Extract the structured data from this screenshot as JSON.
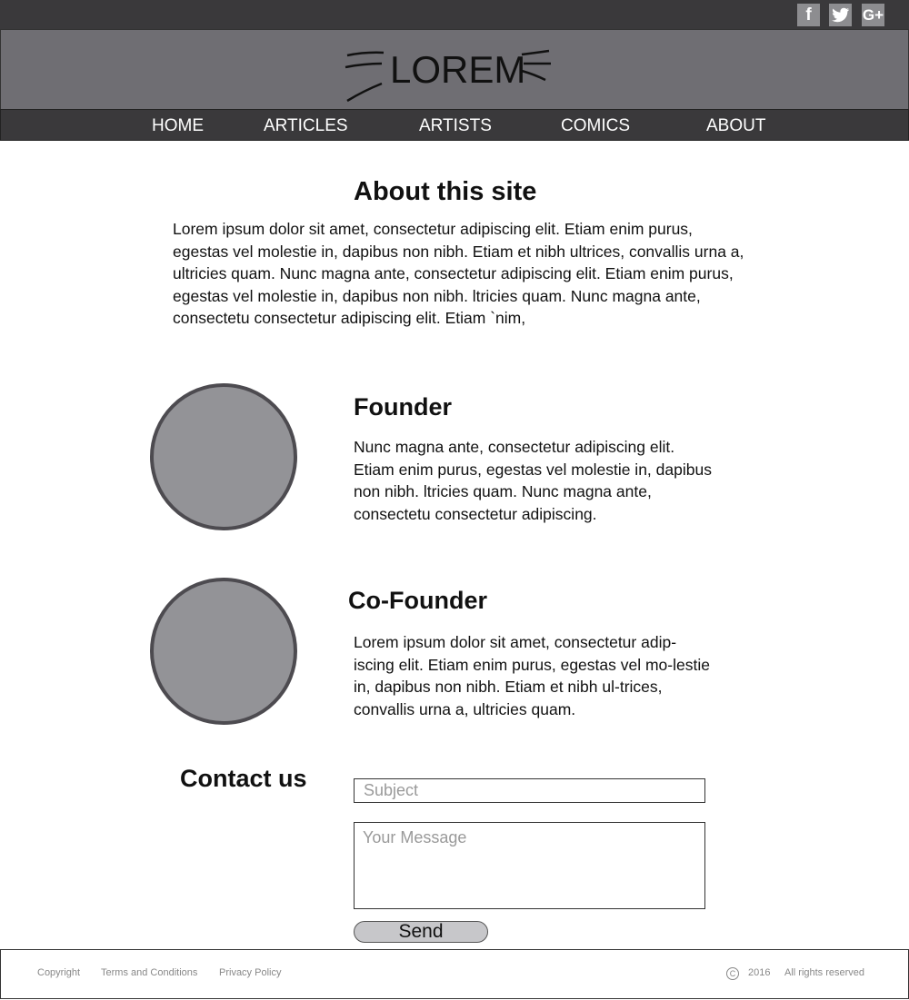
{
  "social": {
    "facebook": "f",
    "twitter": "🐦",
    "googleplus": "G+"
  },
  "logo": {
    "text": "LOREM"
  },
  "nav": [
    "HOME",
    "ARTICLES",
    "ARTISTS",
    "COMICS",
    "ABOUT"
  ],
  "about": {
    "title": "About this site",
    "body": "Lorem ipsum dolor sit amet, consectetur adipiscing elit. Etiam enim purus, egestas vel molestie in, dapibus non nibh. Etiam et nibh ultrices, convallis urna a, ultricies quam. Nunc magna ante,  consectetur adipiscing elit. Etiam enim purus, egestas vel molestie in, dapibus non nibh. ltricies quam. Nunc magna ante,  consectetu   consectetur adipiscing elit. Etiam `nim,"
  },
  "founder": {
    "title": "Founder",
    "body": "Nunc magna ante,  consectetur adipiscing elit. Etiam enim purus, egestas vel molestie in, dapibus non nibh. ltricies quam. Nunc magna ante,  consectetu   consectetur adipiscing."
  },
  "cofounder": {
    "title": "Co-Founder",
    "body": "Lorem ipsum dolor sit amet, consectetur adip-iscing elit. Etiam enim purus, egestas vel mo-lestie in, dapibus non nibh. Etiam et nibh ul-trices, convallis urna a, ultricies quam."
  },
  "contact": {
    "title": "Contact us",
    "subject_placeholder": "Subject",
    "message_placeholder": "Your Message",
    "send_label": "Send"
  },
  "footer": {
    "copyright": "Copyright",
    "terms": "Terms and Conditions",
    "privacy": "Privacy Policy",
    "copy_symbol": "C",
    "year": "2016",
    "rights": "All rights reserved"
  },
  "colors": {
    "topbar": "#3a393b",
    "header": "#6f6e73",
    "avatar": "#939397",
    "avatar_border": "#4d4b50"
  }
}
